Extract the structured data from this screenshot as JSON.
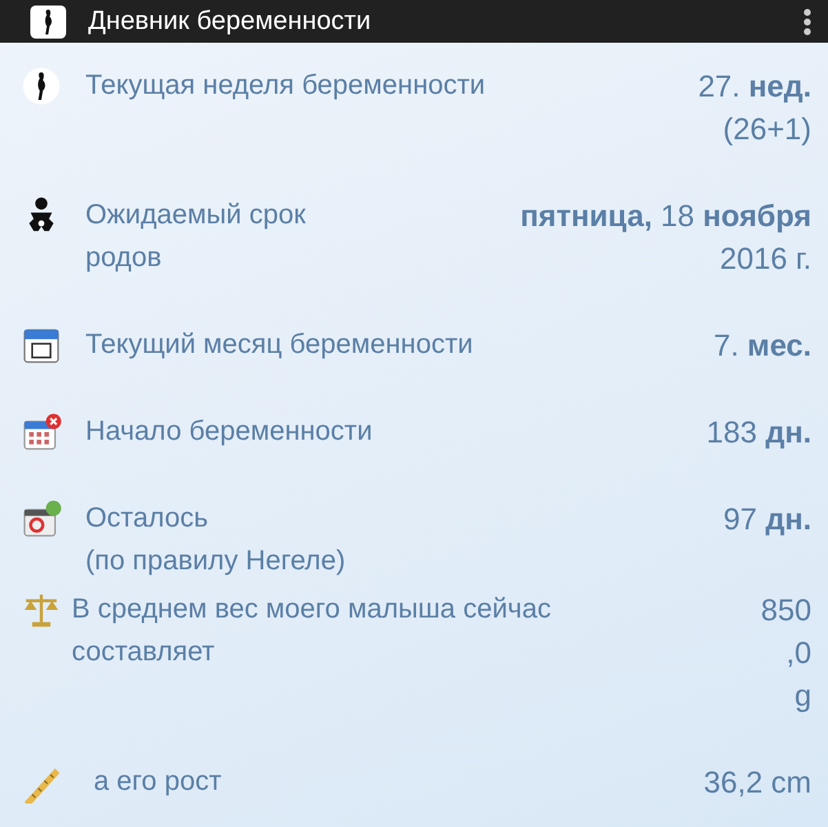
{
  "app_bar": {
    "title": "Дневник беременности"
  },
  "rows": [
    {
      "label": "Текущая неделя беременности",
      "value": [
        "27. **нед.**",
        "(26+1)"
      ]
    },
    {
      "label": "Ожидаемый срок родов",
      "value": [
        "**пятница,** 18 **ноября**",
        "2016 г."
      ]
    },
    {
      "label": "Текущий месяц беременности",
      "value": [
        "7. **мес.**"
      ]
    },
    {
      "label": "Начало беременности",
      "value": [
        "183 **дн.**"
      ]
    },
    {
      "label": "Осталось\n(по правилу Негеле)",
      "value": [
        "97 **дн.**"
      ]
    },
    {
      "label": "В среднем вес моего малыша сейчас составляет",
      "value": [
        "850",
        ",0",
        "g"
      ]
    },
    {
      "label": "а его рост",
      "value": [
        "36,2 cm"
      ]
    }
  ]
}
